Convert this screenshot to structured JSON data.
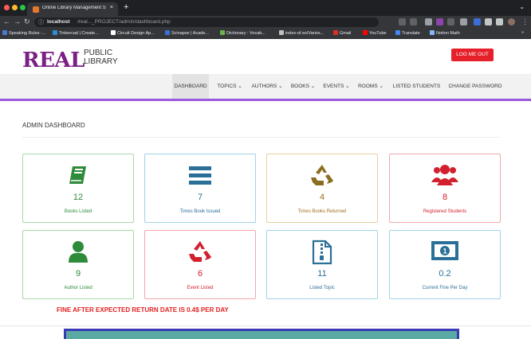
{
  "browser": {
    "tab_title": "Online Library Management Sy",
    "tab_close": "×",
    "new_tab": "+",
    "tab_menu": "⌄",
    "url_host": "localhost",
    "url_path": "/real..._PROJECT/admin/dashboard.php",
    "bookmarks": [
      {
        "label": "Speaking Rules -...",
        "color": "#4a7bd0"
      },
      {
        "label": "Tinkercad | Create...",
        "color": "#2d8fd1"
      },
      {
        "label": "Circuit Design Ap...",
        "color": "#ffffff"
      },
      {
        "label": "Scinapse | Acade...",
        "color": "#3b6fd6"
      },
      {
        "label": "Dictionary : Vocab...",
        "color": "#6bb34a"
      },
      {
        "label": "index-of.es/Varios...",
        "color": "#c0c0c0"
      },
      {
        "label": "Gmail",
        "color": "#d93025"
      },
      {
        "label": "YouTube",
        "color": "#ff0000"
      },
      {
        "label": "Translate",
        "color": "#4285f4"
      },
      {
        "label": "Notion Math",
        "color": "#8ab4f8"
      }
    ],
    "bookmarks_more": "»"
  },
  "site": {
    "logo_main": "REAL",
    "logo_line1": "PUBLIC",
    "logo_line2": "LIBRARY",
    "logout_label": "LOG ME OUT"
  },
  "menu": [
    {
      "label": "DASHBOARD",
      "active": true
    },
    {
      "label": "TOPICS ⌄"
    },
    {
      "label": "AUTHORS ⌄"
    },
    {
      "label": "BOOKS ⌄"
    },
    {
      "label": "EVENTS ⌄"
    },
    {
      "label": "ROOMS ⌄"
    },
    {
      "label": "LISTED STUDENTS"
    },
    {
      "label": "CHANGE PASSWORD"
    }
  ],
  "page_title": "ADMIN DASHBOARD",
  "cards": [
    {
      "value": "12",
      "label": "Books Listed",
      "color": "green",
      "icon": "book-icon"
    },
    {
      "value": "7",
      "label": "Times Book Issued",
      "color": "blue",
      "icon": "bars-icon"
    },
    {
      "value": "4",
      "label": "Times Books Returned",
      "color": "gold",
      "icon": "recycle-icon"
    },
    {
      "value": "8",
      "label": "Registered Students",
      "color": "red",
      "icon": "users-icon"
    },
    {
      "value": "9",
      "label": "Author Listed",
      "color": "green",
      "icon": "user-icon"
    },
    {
      "value": "6",
      "label": "Event Listed",
      "color": "red",
      "icon": "recycle-icon"
    },
    {
      "value": "11",
      "label": "Listed Topic",
      "color": "blue",
      "icon": "file-zip-icon"
    },
    {
      "value": "0.2",
      "label": "Current Fine Per Day",
      "color": "blue",
      "icon": "money-icon"
    }
  ],
  "fine_notice": "FINE AFTER EXPECTED RETURN DATE IS 0.4$ PER DAY"
}
